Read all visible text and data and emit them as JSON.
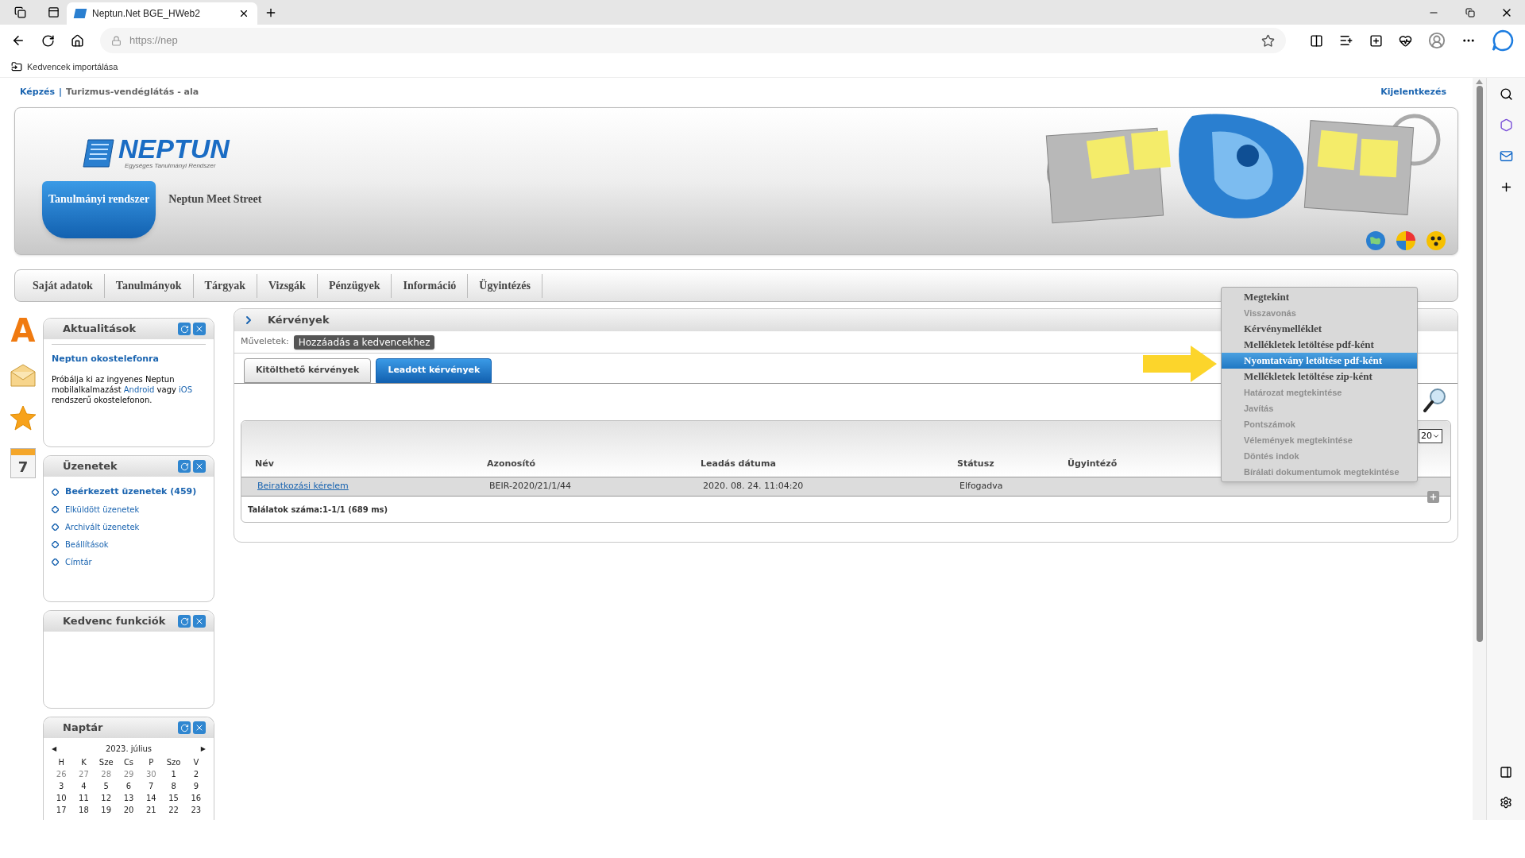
{
  "browser": {
    "tabs": [
      {
        "title": "Neptun.Net BGE_HWeb2",
        "selected": true
      }
    ],
    "address": "https://nep",
    "favorites": [
      {
        "label": "Kedvencek importálása"
      }
    ]
  },
  "top_links": {
    "breadcrumb": [
      "Képzés",
      "Turizmus-vendéglátás - ala"
    ],
    "separator": "|",
    "logout": "Kijelentkezés"
  },
  "header": {
    "logo": "NEPTUN",
    "logo_subtitle": "Egységes Tanulmányi Rendszer",
    "tabs": [
      {
        "label": "Tanulmányi rendszer",
        "selected": true
      },
      {
        "label": "Neptun Meet Street",
        "selected": false
      }
    ]
  },
  "menu": [
    "Saját adatok",
    "Tanulmányok",
    "Tárgyak",
    "Vizsgák",
    "Pénzügyek",
    "Információ",
    "Ügyintézés"
  ],
  "side_icons": [
    {
      "kind": "letter",
      "text": "A"
    },
    {
      "kind": "envelope"
    },
    {
      "kind": "star"
    },
    {
      "kind": "calendar",
      "text": "7"
    }
  ],
  "panels": [
    {
      "kind": "news",
      "title": "Aktualitások",
      "headline": "Neptun okostelefonra",
      "parts": [
        {
          "text": "Próbálja ki az ingyenes Neptun mobilalkalmazást ",
          "link": false
        },
        {
          "text": "Android",
          "link": true
        },
        {
          "text": " vagy ",
          "link": false
        },
        {
          "text": "iOS",
          "link": true
        },
        {
          "text": " rendszerű okostelefonon.",
          "link": false
        }
      ]
    },
    {
      "kind": "links",
      "title": "Üzenetek",
      "items": [
        {
          "label": "Beérkezett üzenetek (459)",
          "bold": true
        },
        {
          "label": "Elküldött üzenetek",
          "bold": false
        },
        {
          "label": "Archivált üzenetek",
          "bold": false
        },
        {
          "label": "Beállítások",
          "bold": false
        },
        {
          "label": "Címtár",
          "bold": false
        }
      ]
    },
    {
      "kind": "empty",
      "title": "Kedvenc funkciók"
    },
    {
      "kind": "calendar",
      "title": "Naptár",
      "month": "2023. július",
      "prev": "◀",
      "next": "▶",
      "weekdays": [
        "H",
        "K",
        "Sze",
        "Cs",
        "P",
        "Szo",
        "V"
      ],
      "days": [
        {
          "d": "26",
          "other": true
        },
        {
          "d": "27",
          "other": true
        },
        {
          "d": "28",
          "other": true
        },
        {
          "d": "29",
          "other": true
        },
        {
          "d": "30",
          "other": true
        },
        {
          "d": "1",
          "other": false
        },
        {
          "d": "2",
          "other": false
        },
        {
          "d": "3",
          "other": false
        },
        {
          "d": "4",
          "other": false
        },
        {
          "d": "5",
          "other": false
        },
        {
          "d": "6",
          "other": false
        },
        {
          "d": "7",
          "other": false
        },
        {
          "d": "8",
          "other": false
        },
        {
          "d": "9",
          "other": false
        },
        {
          "d": "10",
          "other": false
        },
        {
          "d": "11",
          "other": false
        },
        {
          "d": "12",
          "other": false
        },
        {
          "d": "13",
          "other": false
        },
        {
          "d": "14",
          "other": false
        },
        {
          "d": "15",
          "other": false
        },
        {
          "d": "16",
          "other": false
        },
        {
          "d": "17",
          "other": false
        },
        {
          "d": "18",
          "other": false
        },
        {
          "d": "19",
          "other": false
        },
        {
          "d": "20",
          "other": false
        },
        {
          "d": "21",
          "other": false
        },
        {
          "d": "22",
          "other": false
        },
        {
          "d": "23",
          "other": false
        }
      ]
    }
  ],
  "main": {
    "title": "Kérvények",
    "ops_label": "Műveletek:",
    "ops_button": "Hozzáadás a kedvencekhez",
    "tabs": [
      {
        "label": "Kitölthető kérvények",
        "selected": false
      },
      {
        "label": "Leadott kérvények",
        "selected": true
      }
    ],
    "page_size": "20",
    "columns": [
      "Név",
      "Azonosító",
      "Leadás dátuma",
      "Státusz",
      "Ügyintéző"
    ],
    "rows": [
      {
        "cells": [
          "Beiratkozási kérelem",
          "BEIR-2020/21/1/44",
          "2020. 08. 24. 11:04:20",
          "Elfogadva",
          ""
        ]
      }
    ],
    "footer": "Találatok száma:1-1/1 (689 ms)"
  },
  "context_menu": [
    {
      "label": "Megtekint",
      "disabled": false,
      "selected": false
    },
    {
      "label": "Visszavonás",
      "disabled": true,
      "selected": false
    },
    {
      "label": "Kérvénymelléklet",
      "disabled": false,
      "selected": false
    },
    {
      "label": "Mellékletek letöltése pdf-ként",
      "disabled": false,
      "selected": false
    },
    {
      "label": "Nyomtatvány letöltése pdf-ként",
      "disabled": false,
      "selected": true
    },
    {
      "label": "Mellékletek letöltése zip-ként",
      "disabled": false,
      "selected": false
    },
    {
      "label": "Határozat megtekintése",
      "disabled": true,
      "selected": false
    },
    {
      "label": "Javítás",
      "disabled": true,
      "selected": false
    },
    {
      "label": "Pontszámok",
      "disabled": true,
      "selected": false
    },
    {
      "label": "Vélemények megtekintése",
      "disabled": true,
      "selected": false
    },
    {
      "label": "Döntés indok",
      "disabled": true,
      "selected": false
    },
    {
      "label": "Bírálati dokumentumok megtekintése",
      "disabled": true,
      "selected": false
    }
  ]
}
